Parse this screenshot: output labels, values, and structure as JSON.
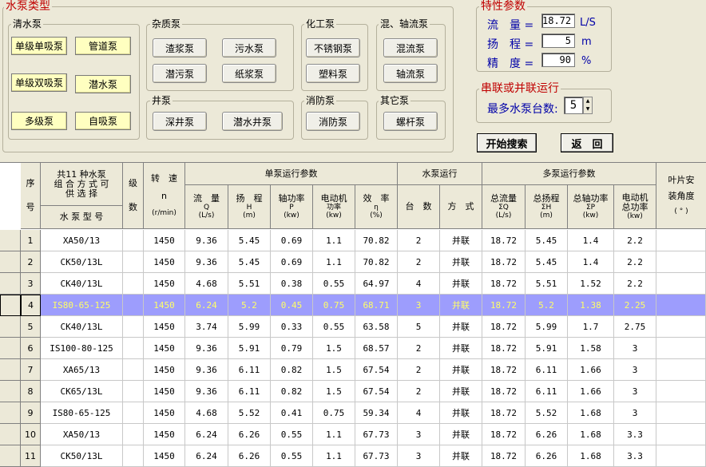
{
  "pump_types": {
    "title": "水泵类型",
    "clear": {
      "title": "清水泵",
      "buttons": [
        "单级单吸泵",
        "管道泵",
        "单级双吸泵",
        "潜水泵",
        "多级泵",
        "自吸泵"
      ]
    },
    "impurity": {
      "title": "杂质泵",
      "buttons": [
        "渣浆泵",
        "污水泵",
        "潜污泵",
        "纸浆泵"
      ]
    },
    "chemical": {
      "title": "化工泵",
      "buttons": [
        "不锈钢泵",
        "塑料泵"
      ]
    },
    "mixed": {
      "title": "混、轴流泵",
      "buttons": [
        "混流泵",
        "轴流泵"
      ]
    },
    "well": {
      "title": "井泵",
      "buttons": [
        "深井泵",
        "潜水井泵"
      ]
    },
    "fire": {
      "title": "消防泵",
      "buttons": [
        "消防泵"
      ]
    },
    "other": {
      "title": "其它泵",
      "buttons": [
        "螺杆泵"
      ]
    }
  },
  "params": {
    "title": "特性参数",
    "flow_label": "流　量 =",
    "flow_value": "18.72",
    "flow_unit": "L/S",
    "head_label": "扬　程 =",
    "head_value": "5",
    "head_unit": "m",
    "precision_label": "精　度 =",
    "precision_value": "90",
    "precision_unit": "%"
  },
  "series": {
    "title": "串联或并联运行",
    "max_label": "最多水泵台数:",
    "max_value": "5"
  },
  "actions": {
    "search": "开始搜索",
    "back": "返　回"
  },
  "table": {
    "h_seq": "序",
    "h_seq2": "号",
    "h_model_top": "共11 种水泵 组 合 方 式 可 供 选 择",
    "h_model": "水 泵 型 号",
    "h_stage": "级",
    "h_stage2": "数",
    "h_speed": "转　速",
    "h_speed2": "n",
    "h_speed3": "(r/min)",
    "h_single": "单泵运行参数",
    "h_pump_run": "水泵运行",
    "h_multi": "多泵运行参数",
    "h_blade": "叶片安",
    "h_blade2": "装角度",
    "h_blade3": "( ° )",
    "h_q1": "流　量",
    "h_q2": "Q",
    "h_q3": "(L/s)",
    "h_h1": "扬　程",
    "h_h2": "H",
    "h_h3": "(m)",
    "h_p1": "轴功率",
    "h_p2": "P",
    "h_p3": "(kw)",
    "h_m1": "电动机",
    "h_m2": "功率",
    "h_m3": "(kw)",
    "h_e1": "效　率",
    "h_e2": "η",
    "h_e3": "(%)",
    "h_cnt": "台　数",
    "h_mode": "方　式",
    "h_tq1": "总流量",
    "h_tq2": "ΣQ",
    "h_tq3": "(L/s)",
    "h_th1": "总扬程",
    "h_th2": "ΣH",
    "h_th3": "(m)",
    "h_tp1": "总轴功率",
    "h_tp2": "ΣP",
    "h_tp3": "(kw)",
    "h_tm1": "电动机",
    "h_tm2": "总功率",
    "h_tm3": "(kw)",
    "rows": [
      [
        "1",
        "XA50/13",
        "",
        "1450",
        "9.36",
        "5.45",
        "0.69",
        "1.1",
        "70.82",
        "2",
        "并联",
        "18.72",
        "5.45",
        "1.4",
        "2.2",
        ""
      ],
      [
        "2",
        "CK50/13L",
        "",
        "1450",
        "9.36",
        "5.45",
        "0.69",
        "1.1",
        "70.82",
        "2",
        "并联",
        "18.72",
        "5.45",
        "1.4",
        "2.2",
        ""
      ],
      [
        "3",
        "CK40/13L",
        "",
        "1450",
        "4.68",
        "5.51",
        "0.38",
        "0.55",
        "64.97",
        "4",
        "并联",
        "18.72",
        "5.51",
        "1.52",
        "2.2",
        ""
      ],
      [
        "4",
        "IS80-65-125",
        "",
        "1450",
        "6.24",
        "5.2",
        "0.45",
        "0.75",
        "68.71",
        "3",
        "并联",
        "18.72",
        "5.2",
        "1.38",
        "2.25",
        ""
      ],
      [
        "5",
        "CK40/13L",
        "",
        "1450",
        "3.74",
        "5.99",
        "0.33",
        "0.55",
        "63.58",
        "5",
        "并联",
        "18.72",
        "5.99",
        "1.7",
        "2.75",
        ""
      ],
      [
        "6",
        "IS100-80-125",
        "",
        "1450",
        "9.36",
        "5.91",
        "0.79",
        "1.5",
        "68.57",
        "2",
        "并联",
        "18.72",
        "5.91",
        "1.58",
        "3",
        ""
      ],
      [
        "7",
        "XA65/13",
        "",
        "1450",
        "9.36",
        "6.11",
        "0.82",
        "1.5",
        "67.54",
        "2",
        "并联",
        "18.72",
        "6.11",
        "1.66",
        "3",
        ""
      ],
      [
        "8",
        "CK65/13L",
        "",
        "1450",
        "9.36",
        "6.11",
        "0.82",
        "1.5",
        "67.54",
        "2",
        "并联",
        "18.72",
        "6.11",
        "1.66",
        "3",
        ""
      ],
      [
        "9",
        "IS80-65-125",
        "",
        "1450",
        "4.68",
        "5.52",
        "0.41",
        "0.75",
        "59.34",
        "4",
        "并联",
        "18.72",
        "5.52",
        "1.68",
        "3",
        ""
      ],
      [
        "10",
        "XA50/13",
        "",
        "1450",
        "6.24",
        "6.26",
        "0.55",
        "1.1",
        "67.73",
        "3",
        "并联",
        "18.72",
        "6.26",
        "1.68",
        "3.3",
        ""
      ],
      [
        "11",
        "CK50/13L",
        "",
        "1450",
        "6.24",
        "6.26",
        "0.55",
        "1.1",
        "67.73",
        "3",
        "并联",
        "18.72",
        "6.26",
        "1.68",
        "3.3",
        ""
      ]
    ],
    "selected_row": 4
  }
}
